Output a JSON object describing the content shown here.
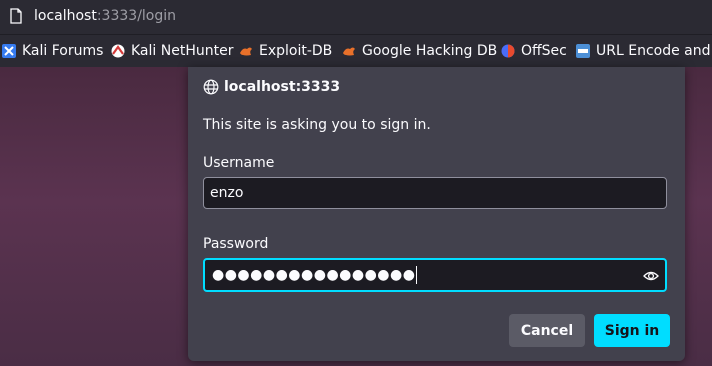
{
  "urlbar": {
    "host": "localhost",
    "path": ":3333/login"
  },
  "bookmarks": [
    {
      "label": "Kali Forums",
      "icon": "kali-forums-icon"
    },
    {
      "label": "Kali NetHunter",
      "icon": "kali-nethunter-icon"
    },
    {
      "label": "Exploit-DB",
      "icon": "exploit-db-icon"
    },
    {
      "label": "Google Hacking DB",
      "icon": "ghdb-icon"
    },
    {
      "label": "OffSec",
      "icon": "offsec-icon"
    },
    {
      "label": "URL Encode and De",
      "icon": "url-encode-icon"
    }
  ],
  "dialog": {
    "origin": "localhost:3333",
    "message": "This site is asking you to sign in.",
    "username_label": "Username",
    "username_value": "enzo",
    "password_label": "Password",
    "password_masked": "●●●●●●●●●●●●●●●●",
    "cancel_label": "Cancel",
    "signin_label": "Sign in"
  },
  "colors": {
    "accent": "#00ddff",
    "dialog_bg": "#42414d",
    "field_bg": "#1c1b22"
  }
}
